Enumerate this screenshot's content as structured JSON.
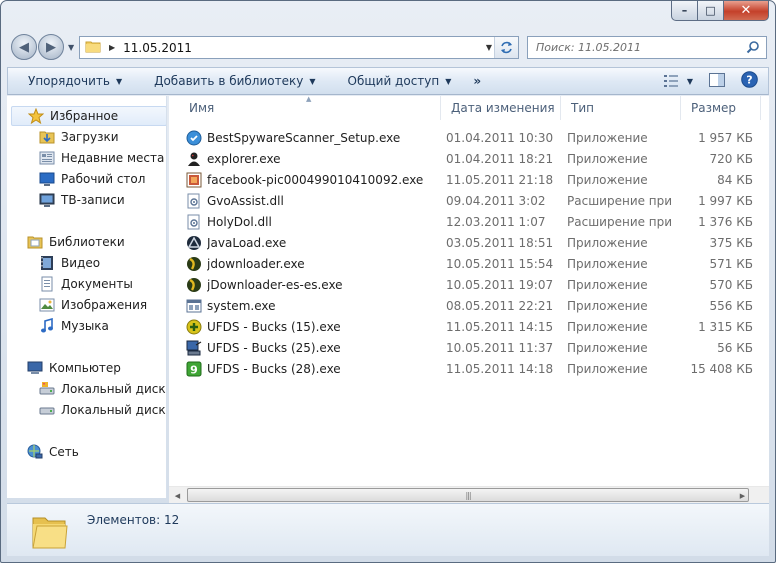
{
  "window": {
    "caption": {
      "minimize": "–",
      "maximize": "□",
      "close": "✕"
    }
  },
  "nav": {
    "back_icon": "arrow-left-icon",
    "forward_icon": "arrow-right-icon",
    "address": {
      "path": "11.05.2011"
    },
    "search": {
      "placeholder": "Поиск: 11.05.2011"
    }
  },
  "toolbar": {
    "organize": "Упорядочить",
    "add_to_library": "Добавить в библиотеку",
    "share": "Общий доступ",
    "more": "»"
  },
  "sidebar": {
    "favorites": "Избранное",
    "favorites_items": [
      "Загрузки",
      "Недавние места",
      "Рабочий стол",
      "ТВ-записи"
    ],
    "libraries": "Библиотеки",
    "libraries_items": [
      "Видео",
      "Документы",
      "Изображения",
      "Музыка"
    ],
    "computer": "Компьютер",
    "computer_items": [
      "Локальный диск (C",
      "Локальный диск (D"
    ],
    "network": "Сеть"
  },
  "columns": {
    "name": "Имя",
    "date": "Дата изменения",
    "type": "Тип",
    "size": "Размер"
  },
  "files": [
    {
      "name": "BestSpywareScanner_Setup.exe",
      "date": "01.04.2011 10:30",
      "type": "Приложение",
      "size": "1 957 КБ",
      "icon": "shield-icon"
    },
    {
      "name": "explorer.exe",
      "date": "01.04.2011 18:21",
      "type": "Приложение",
      "size": "720 КБ",
      "icon": "user-icon"
    },
    {
      "name": "facebook-pic000499010410092.exe",
      "date": "11.05.2011 21:18",
      "type": "Приложение",
      "size": "84 КБ",
      "icon": "picture-icon"
    },
    {
      "name": "GvoAssist.dll",
      "date": "09.04.2011 3:02",
      "type": "Расширение при...",
      "size": "1 997 КБ",
      "icon": "dll-icon"
    },
    {
      "name": "HolyDol.dll",
      "date": "12.03.2011 1:07",
      "type": "Расширение при...",
      "size": "1 376 КБ",
      "icon": "dll-icon"
    },
    {
      "name": "JavaLoad.exe",
      "date": "03.05.2011 18:51",
      "type": "Приложение",
      "size": "375 КБ",
      "icon": "triangle-logo-icon"
    },
    {
      "name": "jdownloader.exe",
      "date": "10.05.2011 15:54",
      "type": "Приложение",
      "size": "571 КБ",
      "icon": "globe-icon"
    },
    {
      "name": "jDownloader-es-es.exe",
      "date": "10.05.2011 19:07",
      "type": "Приложение",
      "size": "570 КБ",
      "icon": "globe-icon"
    },
    {
      "name": "system.exe",
      "date": "08.05.2011 22:21",
      "type": "Приложение",
      "size": "556 КБ",
      "icon": "window-icon"
    },
    {
      "name": "UFDS - Bucks (15).exe",
      "date": "11.05.2011 14:15",
      "type": "Приложение",
      "size": "1 315 КБ",
      "icon": "plus-circle-icon"
    },
    {
      "name": "UFDS - Bucks (25).exe",
      "date": "10.05.2011 11:37",
      "type": "Приложение",
      "size": "56 КБ",
      "icon": "computer-icon"
    },
    {
      "name": "UFDS - Bucks (28).exe",
      "date": "11.05.2011 14:18",
      "type": "Приложение",
      "size": "15 408 КБ",
      "icon": "green-square-icon"
    }
  ],
  "details": {
    "count": "Элементов: 12"
  }
}
